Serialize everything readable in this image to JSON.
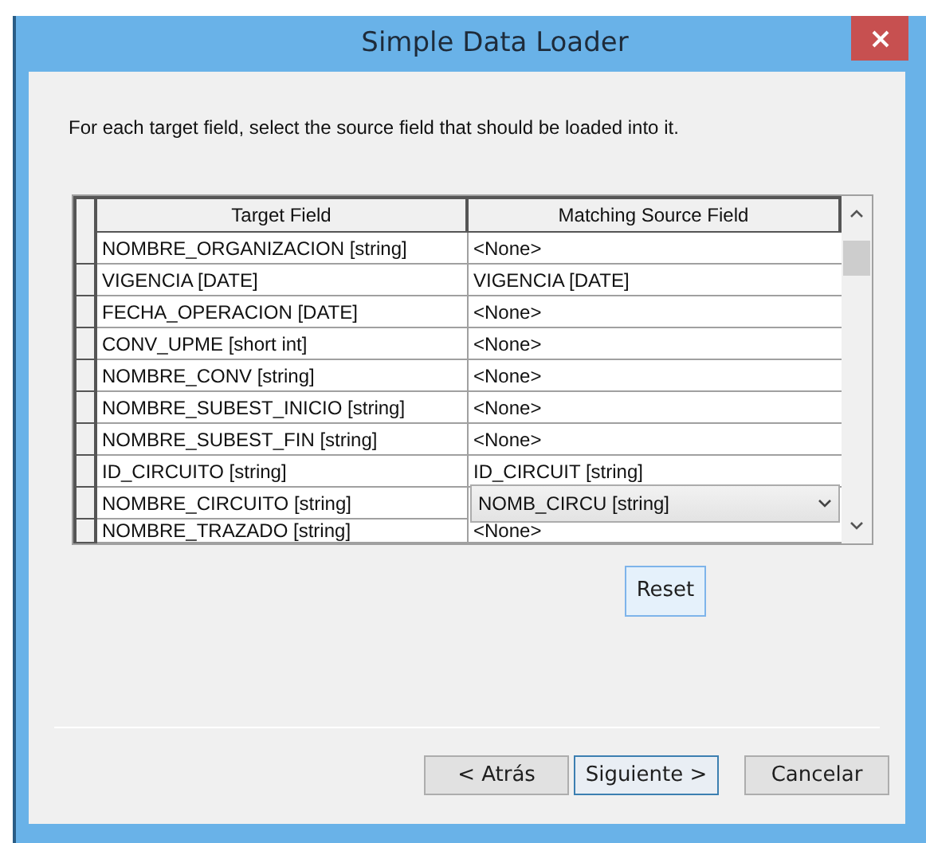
{
  "window": {
    "title": "Simple Data Loader"
  },
  "instruction": "For each target field, select the source field that should be loaded into it.",
  "table": {
    "columns": [
      "Target Field",
      "Matching Source Field"
    ],
    "rows": [
      {
        "target": "NOMBRE_ORGANIZACION [string]",
        "source": "<None>",
        "kind": "text"
      },
      {
        "target": "VIGENCIA [DATE]",
        "source": "VIGENCIA [DATE]",
        "kind": "text"
      },
      {
        "target": "FECHA_OPERACION [DATE]",
        "source": "<None>",
        "kind": "text"
      },
      {
        "target": "CONV_UPME [short int]",
        "source": "<None>",
        "kind": "text"
      },
      {
        "target": "NOMBRE_CONV [string]",
        "source": "<None>",
        "kind": "text"
      },
      {
        "target": "NOMBRE_SUBEST_INICIO [string]",
        "source": "<None>",
        "kind": "text"
      },
      {
        "target": "NOMBRE_SUBEST_FIN [string]",
        "source": "<None>",
        "kind": "text"
      },
      {
        "target": "ID_CIRCUITO [string]",
        "source": "ID_CIRCUIT [string]",
        "kind": "text"
      },
      {
        "target": "NOMBRE_CIRCUITO [string]",
        "source": "NOMB_CIRCU [string]",
        "kind": "dropdown"
      },
      {
        "target": "NOMBRE_TRAZADO [string]",
        "source": "<None>",
        "kind": "text"
      }
    ]
  },
  "reset_button": {
    "label": "Reset",
    "highlighted": true
  },
  "buttons": [
    {
      "label": "< Atrás",
      "default": false
    },
    {
      "label": "Siguiente >",
      "default": true
    },
    {
      "label": "Cancelar",
      "default": false
    }
  ]
}
